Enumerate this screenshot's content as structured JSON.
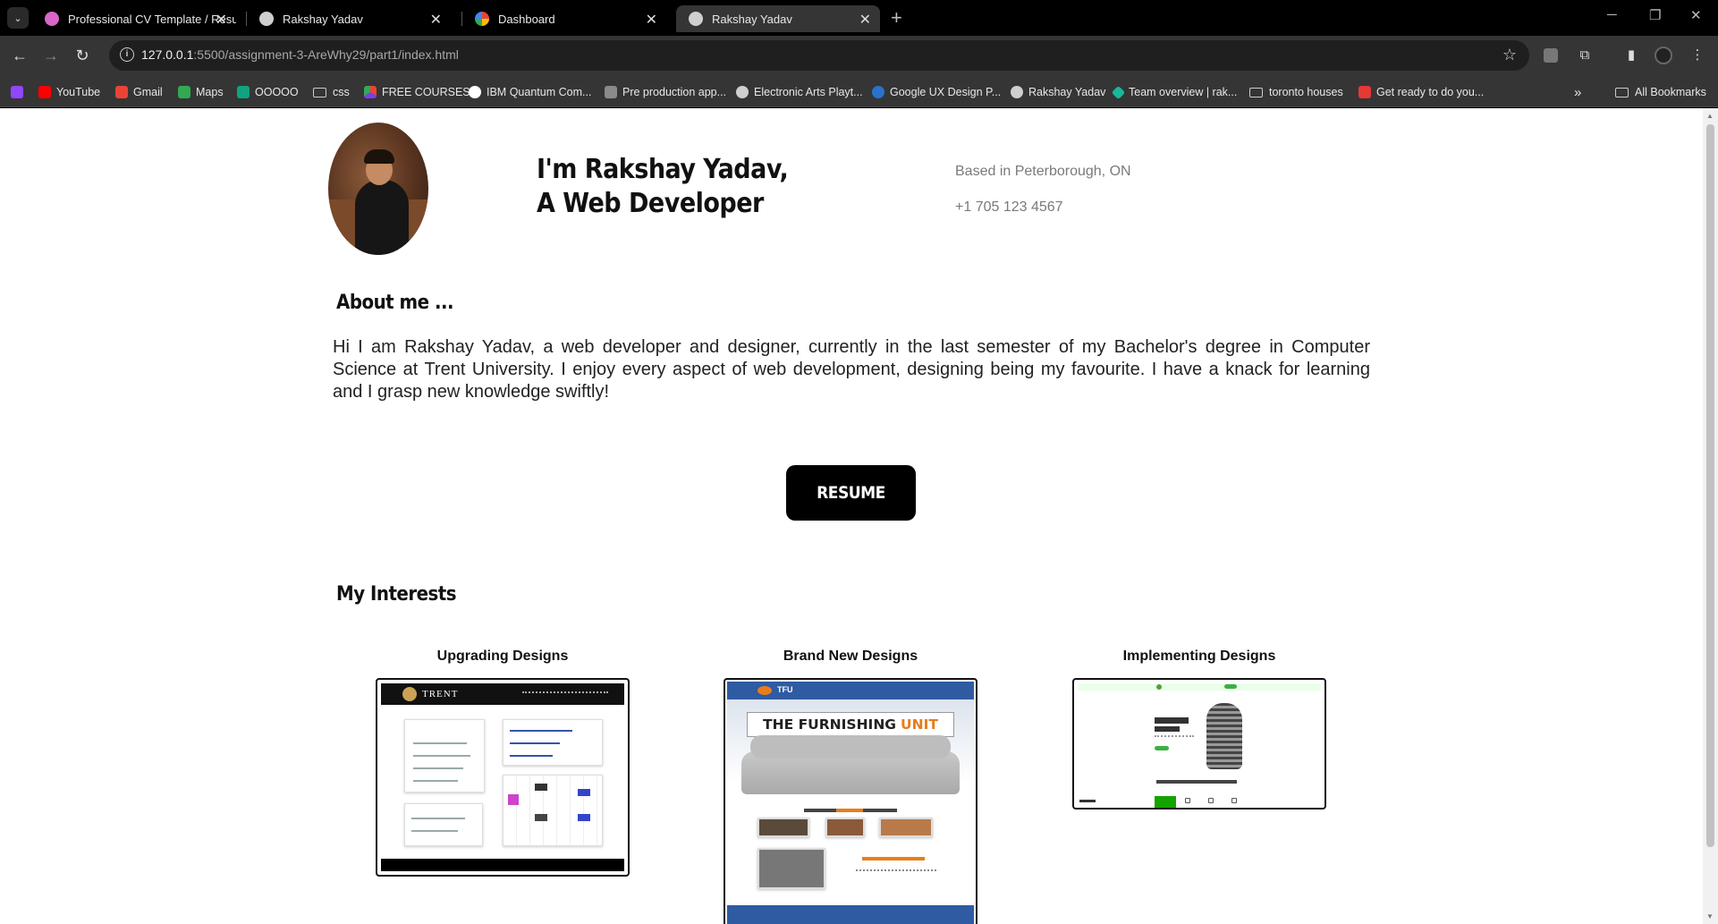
{
  "browser": {
    "tabs": [
      {
        "title": "Professional CV Template / Resu",
        "favicon_color": "#d966c8",
        "active": false
      },
      {
        "title": "Rakshay Yadav",
        "favicon_color": "#cfcfcf",
        "active": false
      },
      {
        "title": "Dashboard",
        "favicon_color": "#f4b400",
        "active": false
      },
      {
        "title": "Rakshay Yadav",
        "favicon_color": "#cfcfcf",
        "active": true
      }
    ],
    "new_tab_label": "+",
    "url_host": "127.0.0.1",
    "url_path": ":5500/assignment-3-AreWhy29/part1/index.html",
    "bookmarks": [
      {
        "label": "YouTube",
        "icon": "youtube-icon",
        "color": "#ff0000"
      },
      {
        "label": "Gmail",
        "icon": "gmail-icon",
        "color": "#ea4335"
      },
      {
        "label": "Maps",
        "icon": "maps-icon",
        "color": "#34a853"
      },
      {
        "label": "OOOOO",
        "icon": "openai-icon",
        "color": "#10a37f"
      },
      {
        "label": "css",
        "icon": "folder-icon",
        "color": ""
      },
      {
        "label": "FREE COURSES",
        "icon": "courses-icon",
        "color": "#7b3fe4"
      },
      {
        "label": "IBM Quantum Com...",
        "icon": "ibm-icon",
        "color": "#ffffff"
      },
      {
        "label": "Pre production app...",
        "icon": "app-icon",
        "color": "#8a8a8a"
      },
      {
        "label": "Electronic Arts Playt...",
        "icon": "globe-icon",
        "color": "#cfcfcf"
      },
      {
        "label": "Google UX Design P...",
        "icon": "coursera-icon",
        "color": "#2a73cc"
      },
      {
        "label": "Rakshay Yadav",
        "icon": "globe-icon",
        "color": "#cfcfcf"
      },
      {
        "label": "Team overview | rak...",
        "icon": "diamond-icon",
        "color": "#19b89a"
      },
      {
        "label": "toronto houses",
        "icon": "folder-icon",
        "color": ""
      },
      {
        "label": "Get ready to do you...",
        "icon": "maple-leaf-icon",
        "color": "#e53935"
      }
    ],
    "overflow_label": "»",
    "all_bookmarks_label": "All Bookmarks"
  },
  "page": {
    "hero_line1": "I'm Rakshay Yadav,",
    "hero_line2": "A Web Developer",
    "location": "Based in Peterborough, ON",
    "phone": "+1 705 123 4567",
    "about_heading": "About me ...",
    "about_text": "Hi I am Rakshay Yadav, a web developer and designer, currently in the last semester of my Bachelor's degree in Computer Science at Trent University. I enjoy every aspect of web development, designing being my favourite. I have a knack for learning and I grasp new knowledge swiftly!",
    "resume_label": "RESUME",
    "interests_heading": "My Interests",
    "interests": [
      {
        "title": "Upgrading Designs",
        "thumb_brand": "TRENT"
      },
      {
        "title": "Brand New Designs",
        "thumb_brand": "TFU",
        "thumb_banner": "THE FURNISHING",
        "thumb_banner_accent": "UNIT"
      },
      {
        "title": "Implementing Designs"
      }
    ]
  }
}
